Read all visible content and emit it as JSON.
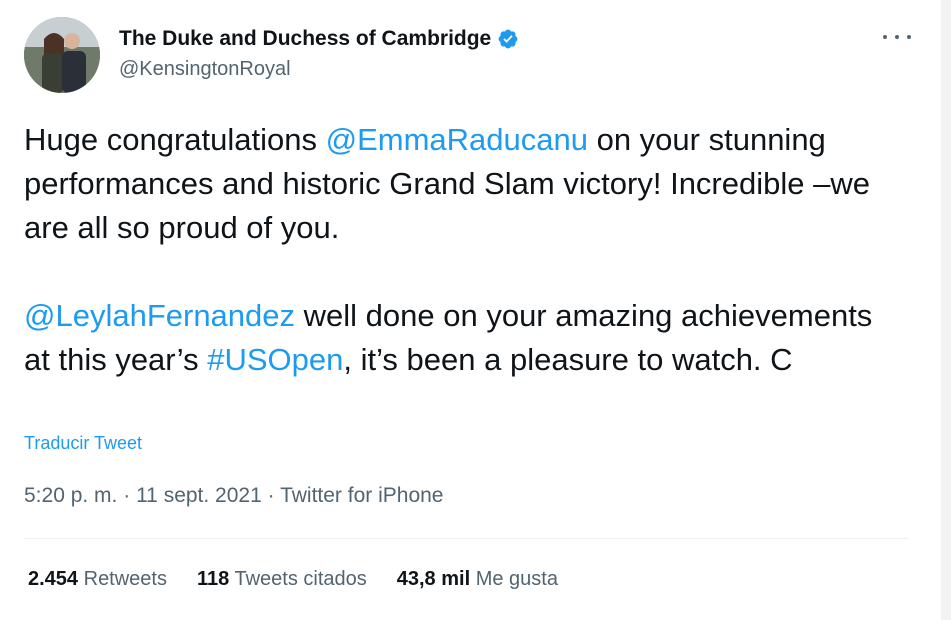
{
  "author": {
    "display_name": "The Duke and Duchess of Cambridge",
    "handle": "@KensingtonRoyal",
    "verified": true,
    "avatar_icon": "couple-photo-avatar"
  },
  "tweet": {
    "paragraph1": {
      "t1": "Huge congratulations ",
      "mention1": "@EmmaRaducanu",
      "t2": " on your stunning performances and historic Grand Slam victory! Incredible –we are all so proud of you."
    },
    "paragraph2": {
      "mention2": "@LeylahFernandez",
      "t3": " well done on your amazing achievements at this year’s ",
      "hashtag": "#USOpen",
      "t4": ", it’s been a pleasure to watch. C"
    },
    "translate_label": "Traducir Tweet",
    "time": "5:20 p. m.",
    "date": "11 sept. 2021",
    "source": "Twitter for iPhone",
    "separator": " · "
  },
  "stats": {
    "retweets_count": "2.454",
    "retweets_label": " Retweets",
    "quotes_count": "118",
    "quotes_label": " Tweets citados",
    "likes_count": "43,8 mil",
    "likes_label": " Me gusta"
  },
  "colors": {
    "link": "#1d9bf0",
    "text": "#0f1419",
    "muted": "#536471",
    "verified": "#1d9bf0"
  }
}
